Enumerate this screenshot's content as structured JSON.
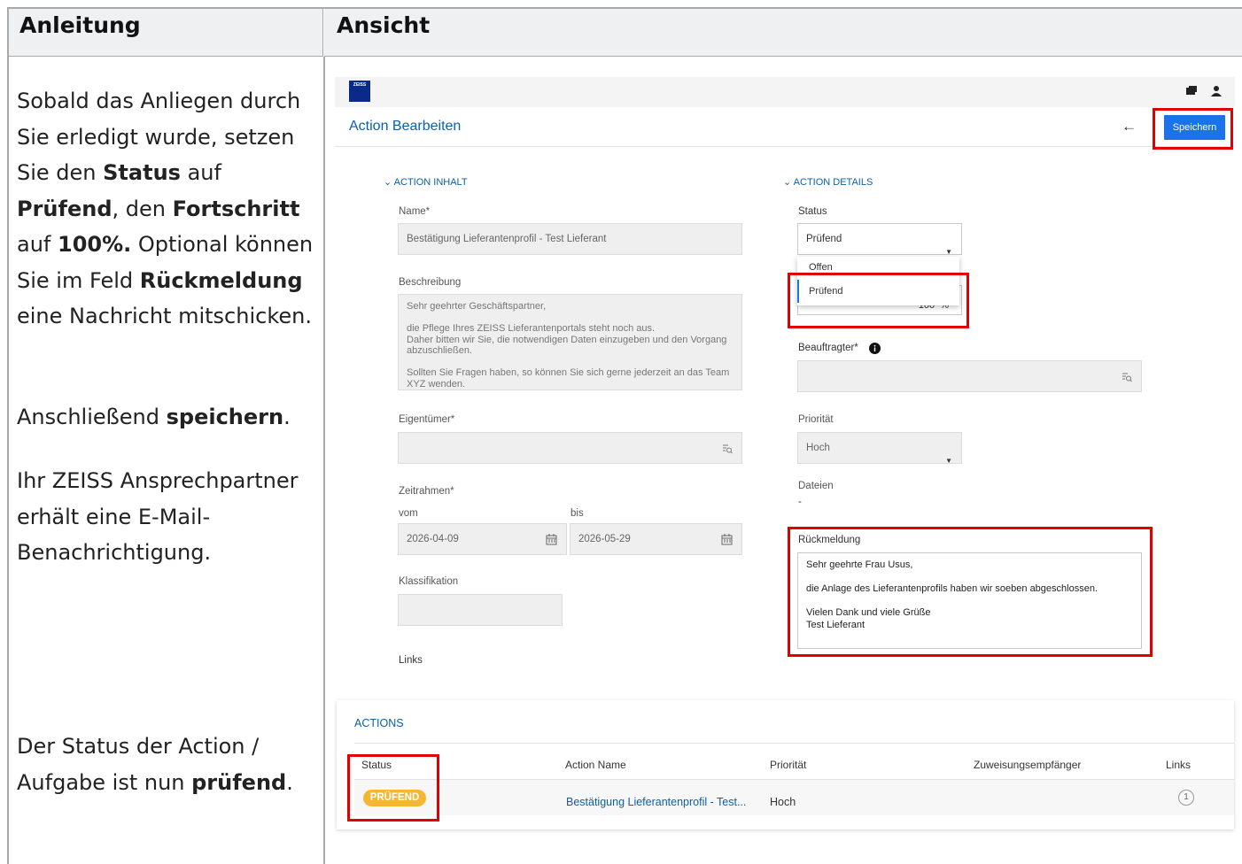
{
  "columns": {
    "left": "Anleitung",
    "right": "Ansicht"
  },
  "instructions": {
    "p1_a": "Sobald das Anliegen durch Sie erledigt wurde, setzen Sie den ",
    "p1_status": "Status",
    "p1_b": " auf ",
    "p1_pruefend": "Prüfend",
    "p1_c": ", den ",
    "p1_fortschritt": "Fortschritt",
    "p1_d": " auf ",
    "p1_100": "100%.",
    "p1_e": " Optional können Sie im Feld ",
    "p1_rueck": "Rückmeldung",
    "p1_f": " eine Nachricht mitschicken.",
    "p2_a": "Anschließend ",
    "p2_b": "speichern",
    "p2_c": ".",
    "p3": "Ihr ZEISS Ansprechpartner erhält eine E-Mail-Benachrichtigung.",
    "p4_a": "Der Status der Action / Aufgabe ist nun ",
    "p4_b": "prüfend",
    "p4_c": "."
  },
  "app": {
    "logo_text": "ZEISS",
    "page_title": "Action Bearbeiten",
    "back_glyph": "←",
    "save_label": "Speichern",
    "section_content": "⌄ ACTION INHALT",
    "section_details": "⌄ ACTION DETAILS",
    "name_label": "Name*",
    "name_value": "Bestätigung Lieferantenprofil - Test Lieferant",
    "desc_label": "Beschreibung",
    "desc_value": "Sehr geehrter Geschäftspartner,\n\ndie Pflege Ihres ZEISS Lieferantenportals steht noch aus.\nDaher bitten wir Sie, die notwendigen Daten einzugeben und den Vorgang abzuschließen.\n\nSollten Sie Fragen haben, so können Sie sich gerne jederzeit an das Team XYZ wenden.",
    "owner_label": "Eigentümer*",
    "timeframe_label": "Zeitrahmen*",
    "from_label": "vom",
    "to_label": "bis",
    "from_value": "2026-04-09",
    "to_value": "2026-05-29",
    "class_label": "Klassifikation",
    "links_label": "Links",
    "status_label": "Status",
    "status_value": "Prüfend",
    "status_options": [
      "Offen",
      "Prüfend"
    ],
    "progress_value": "100",
    "progress_unit": "%",
    "assignee_label": "Beauftragter*",
    "priority_label": "Priorität",
    "priority_value": "Hoch",
    "files_label": "Dateien",
    "files_value": "-",
    "feedback_label": "Rückmeldung",
    "feedback_value": "Sehr geehrte Frau Usus,\n\ndie Anlage des Lieferantenprofils haben wir soeben abgeschlossen.\n\nVielen Dank und viele Grüße\nTest Lieferant"
  },
  "actions_table": {
    "title": "ACTIONS",
    "headers": [
      "Status",
      "Action Name",
      "Priorität",
      "Zuweisungsempfänger",
      "Links"
    ],
    "row": {
      "status": "PRÜFEND",
      "name": "Bestätigung Lieferantenprofil - Test...",
      "priority": "Hoch",
      "assignee": "",
      "links": "1"
    }
  },
  "colors": {
    "accent": "#1a73e8",
    "link": "#0b5fad",
    "highlight": "#e00000",
    "badge": "#f5b731"
  }
}
